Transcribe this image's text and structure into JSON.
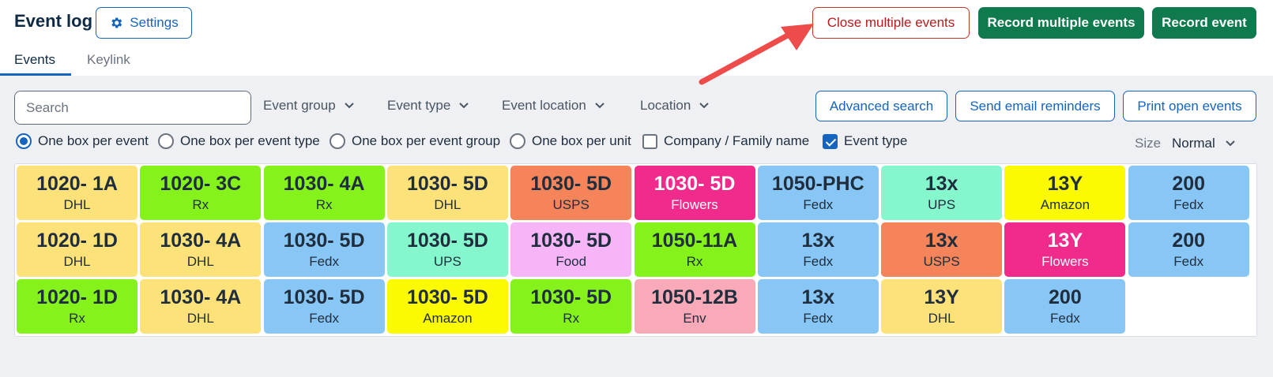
{
  "header": {
    "title": "Event log",
    "settings_label": "Settings",
    "close_multiple_label": "Close multiple events",
    "record_multiple_label": "Record multiple events",
    "record_event_label": "Record event"
  },
  "tabs": [
    {
      "label": "Events",
      "active": true
    },
    {
      "label": "Keylink",
      "active": false
    }
  ],
  "filters": {
    "search_placeholder": "Search",
    "dropdowns": [
      "Event group",
      "Event type",
      "Event location",
      "Location"
    ],
    "advanced_search_label": "Advanced search",
    "send_reminders_label": "Send email reminders",
    "print_open_label": "Print open events"
  },
  "view_options": {
    "radios": [
      {
        "label": "One box per event",
        "selected": true
      },
      {
        "label": "One box per event type",
        "selected": false
      },
      {
        "label": "One box per event group",
        "selected": false
      },
      {
        "label": "One box per unit",
        "selected": false
      }
    ],
    "checkboxes": [
      {
        "label": "Company / Family name",
        "checked": false
      },
      {
        "label": "Event type",
        "checked": true
      }
    ],
    "size_label": "Size",
    "size_value": "Normal"
  },
  "colors": {
    "accent": "#1565c0",
    "green": "#0e7a4e",
    "red": "#b71c1c"
  },
  "tiles": [
    {
      "unit": "1020- 1A",
      "type": "DHL",
      "color": "#fde27a",
      "text": "#1f2d3d"
    },
    {
      "unit": "1020- 3C",
      "type": "Rx",
      "color": "#85f21c",
      "text": "#1f2d3d"
    },
    {
      "unit": "1030- 4A",
      "type": "Rx",
      "color": "#85f21c",
      "text": "#1f2d3d"
    },
    {
      "unit": "1030- 5D",
      "type": "DHL",
      "color": "#fde27a",
      "text": "#1f2d3d"
    },
    {
      "unit": "1030- 5D",
      "type": "USPS",
      "color": "#f5845a",
      "text": "#1f2d3d"
    },
    {
      "unit": "1030- 5D",
      "type": "Flowers",
      "color": "#f02b8c",
      "text": "#ffffff"
    },
    {
      "unit": "1050-PHC",
      "type": "Fedx",
      "color": "#88c7f5",
      "text": "#1f2d3d"
    },
    {
      "unit": "13x",
      "type": "UPS",
      "color": "#86f7cc",
      "text": "#1f2d3d"
    },
    {
      "unit": "13Y",
      "type": "Amazon",
      "color": "#fbfa02",
      "text": "#1f2d3d"
    },
    {
      "unit": "200",
      "type": "Fedx",
      "color": "#88c7f5",
      "text": "#1f2d3d"
    },
    {
      "unit": "1020- 1D",
      "type": "DHL",
      "color": "#fde27a",
      "text": "#1f2d3d"
    },
    {
      "unit": "1030- 4A",
      "type": "DHL",
      "color": "#fde27a",
      "text": "#1f2d3d"
    },
    {
      "unit": "1030- 5D",
      "type": "Fedx",
      "color": "#88c7f5",
      "text": "#1f2d3d"
    },
    {
      "unit": "1030- 5D",
      "type": "UPS",
      "color": "#86f7cc",
      "text": "#1f2d3d"
    },
    {
      "unit": "1030- 5D",
      "type": "Food",
      "color": "#f5b5f7",
      "text": "#1f2d3d"
    },
    {
      "unit": "1050-11A",
      "type": "Rx",
      "color": "#85f21c",
      "text": "#1f2d3d"
    },
    {
      "unit": "13x",
      "type": "Fedx",
      "color": "#88c7f5",
      "text": "#1f2d3d"
    },
    {
      "unit": "13x",
      "type": "USPS",
      "color": "#f5845a",
      "text": "#1f2d3d"
    },
    {
      "unit": "13Y",
      "type": "Flowers",
      "color": "#f02b8c",
      "text": "#ffffff"
    },
    {
      "unit": "200",
      "type": "Fedx",
      "color": "#88c7f5",
      "text": "#1f2d3d"
    },
    {
      "unit": "1020- 1D",
      "type": "Rx",
      "color": "#85f21c",
      "text": "#1f2d3d"
    },
    {
      "unit": "1030- 4A",
      "type": "DHL",
      "color": "#fde27a",
      "text": "#1f2d3d"
    },
    {
      "unit": "1030- 5D",
      "type": "Fedx",
      "color": "#88c7f5",
      "text": "#1f2d3d"
    },
    {
      "unit": "1030- 5D",
      "type": "Amazon",
      "color": "#fbfa02",
      "text": "#1f2d3d"
    },
    {
      "unit": "1030- 5D",
      "type": "Rx",
      "color": "#85f21c",
      "text": "#1f2d3d"
    },
    {
      "unit": "1050-12B",
      "type": "Env",
      "color": "#f9aab8",
      "text": "#1f2d3d"
    },
    {
      "unit": "13x",
      "type": "Fedx",
      "color": "#88c7f5",
      "text": "#1f2d3d"
    },
    {
      "unit": "13Y",
      "type": "DHL",
      "color": "#fde27a",
      "text": "#1f2d3d"
    },
    {
      "unit": "200",
      "type": "Fedx",
      "color": "#88c7f5",
      "text": "#1f2d3d"
    }
  ]
}
